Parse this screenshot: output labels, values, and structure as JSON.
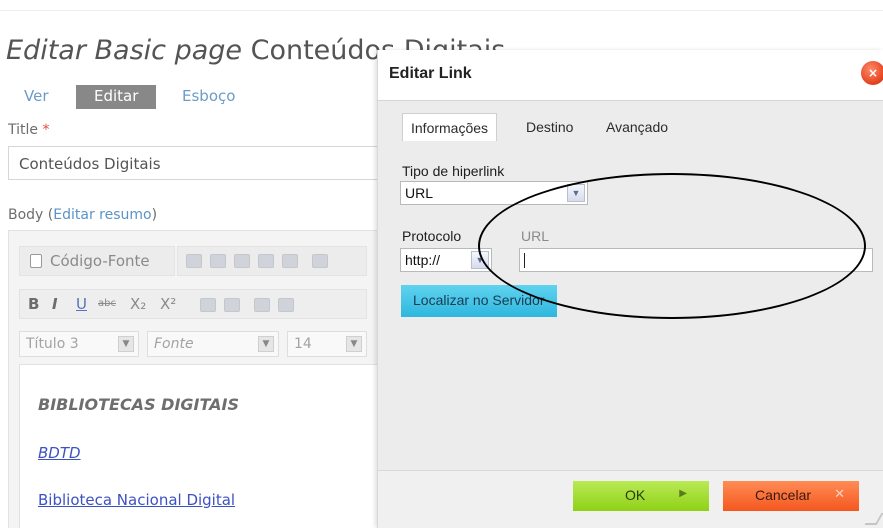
{
  "page": {
    "title_italic": "Editar Basic page",
    "title_node": "Conteúdos Digitais",
    "tabs": [
      {
        "label": "Ver"
      },
      {
        "label": "Editar"
      },
      {
        "label": "Esboço"
      }
    ]
  },
  "form": {
    "title_label": "Title",
    "required_mark": "*",
    "title_value": "Conteúdos Digitais",
    "body_label": "Body",
    "body_paren_open": "(",
    "body_link": "Editar resumo",
    "body_paren_close": ")"
  },
  "editor": {
    "toolbar": {
      "source_label": "Código-Fonte",
      "bold": "B",
      "italic": "I",
      "underline": "U",
      "strike": "abc",
      "subscript": "X₂",
      "superscript": "X²",
      "format_value": "Título 3",
      "font_placeholder": "Fonte",
      "size_value": "14"
    },
    "content": {
      "heading": "BIBLIOTECAS DIGITAIS",
      "link1": "BDTD",
      "link2": "Biblioteca Nacional Digital"
    }
  },
  "dialog": {
    "title": "Editar Link",
    "close_glyph": "×",
    "tabs": [
      {
        "label": "Informações"
      },
      {
        "label": "Destino"
      },
      {
        "label": "Avançado"
      }
    ],
    "link_type_label": "Tipo de hiperlink",
    "link_type_value": "URL",
    "protocol_label": "Protocolo",
    "protocol_value": "http://",
    "url_label": "URL",
    "url_value": "",
    "browse_button": "Localizar no Servidor",
    "ok_button": "OK",
    "cancel_button": "Cancelar"
  }
}
